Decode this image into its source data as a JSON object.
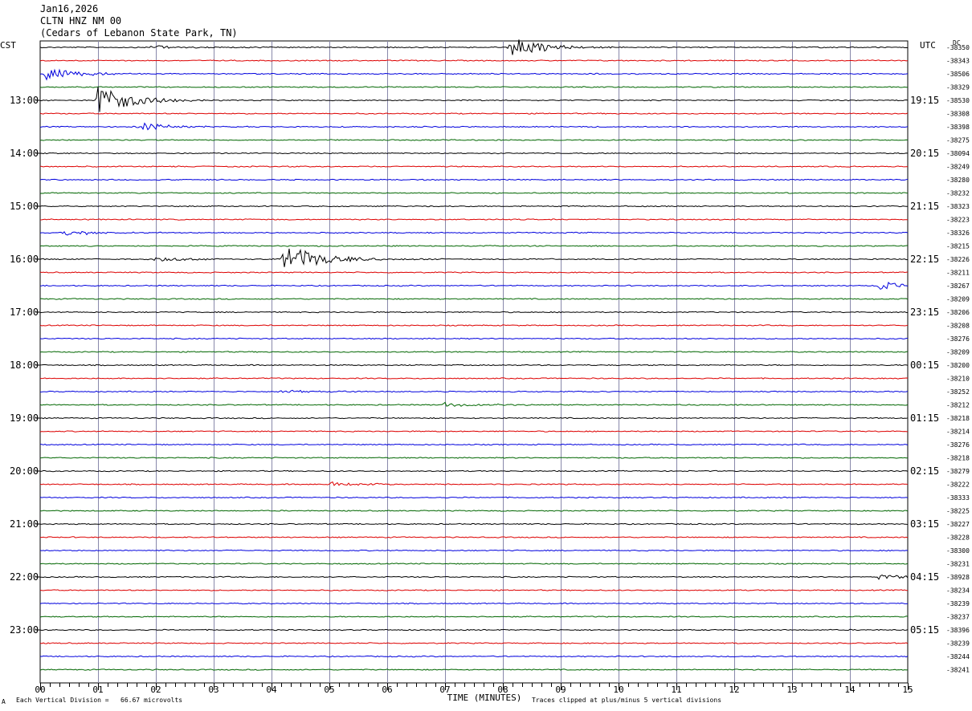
{
  "header": {
    "date": "Jan16,2026",
    "station": "CLTN HNZ NM 00",
    "location": "(Cedars of Lebanon State Park, TN)",
    "left_zone": "CST",
    "right_zone": "UTC",
    "dc_label": "DC"
  },
  "footer": {
    "scale_note": "Each Vertical Division =   66.67 microvolts",
    "clip_note": "Traces clipped at plus/minus 5 vertical divisions",
    "corner_mark": "A"
  },
  "chart_data": {
    "type": "line",
    "title": "",
    "xlabel": "TIME (MINUTES)",
    "ylabel": "",
    "xlim": [
      0,
      15
    ],
    "x_ticks": [
      "00",
      "01",
      "02",
      "03",
      "04",
      "05",
      "06",
      "07",
      "08",
      "09",
      "10",
      "11",
      "12",
      "13",
      "14",
      "15"
    ],
    "trace_colors": [
      "#000000",
      "#dd0000",
      "#0000dd",
      "#006600"
    ],
    "left_hour_labels": [
      "13:00",
      "14:00",
      "15:00",
      "16:00",
      "17:00",
      "18:00",
      "19:00",
      "20:00",
      "21:00",
      "22:00",
      "23:00"
    ],
    "right_hour_labels": [
      "19:15",
      "20:15",
      "21:15",
      "22:15",
      "23:15",
      "00:15",
      "01:15",
      "02:15",
      "03:15",
      "04:15",
      "05:15"
    ],
    "dc_offsets": [
      "-38350",
      "-38343",
      "-38506",
      "-38329",
      "-38530",
      "-38308",
      "-38398",
      "-38275",
      "-38094",
      "-38249",
      "-38280",
      "-38232",
      "-38323",
      "-38223",
      "-38326",
      "-38215",
      "-38226",
      "-38211",
      "-38267",
      "-38209",
      "-38206",
      "-38208",
      "-38276",
      "-38209",
      "-38200",
      "-38210",
      "-38252",
      "-38212",
      "-38218",
      "-38214",
      "-38276",
      "-38218",
      "-38279",
      "-38222",
      "-38333",
      "-38225",
      "-38227",
      "-38228",
      "-38300",
      "-38231",
      "-38928",
      "-38234",
      "-38239",
      "-38237",
      "-38396",
      "-38239",
      "-38244",
      "-38241"
    ],
    "events": [
      {
        "trace": 0,
        "minute": 1.9,
        "amplitude": 0.15
      },
      {
        "trace": 0,
        "minute": 8.1,
        "amplitude": 0.85
      },
      {
        "trace": 2,
        "minute": 0.1,
        "amplitude": 0.5
      },
      {
        "trace": 4,
        "minute": 1.0,
        "amplitude": 1.2
      },
      {
        "trace": 6,
        "minute": 1.7,
        "amplitude": 0.3
      },
      {
        "trace": 14,
        "minute": 0.4,
        "amplitude": 0.25
      },
      {
        "trace": 16,
        "minute": 2.0,
        "amplitude": 0.2
      },
      {
        "trace": 16,
        "minute": 4.2,
        "amplitude": 1.2
      },
      {
        "trace": 18,
        "minute": 14.5,
        "amplitude": 0.3
      },
      {
        "trace": 26,
        "minute": 4.1,
        "amplitude": 0.15
      },
      {
        "trace": 27,
        "minute": 7.0,
        "amplitude": 0.2
      },
      {
        "trace": 33,
        "minute": 5.0,
        "amplitude": 0.2
      },
      {
        "trace": 40,
        "minute": 14.5,
        "amplitude": 0.2
      }
    ]
  }
}
